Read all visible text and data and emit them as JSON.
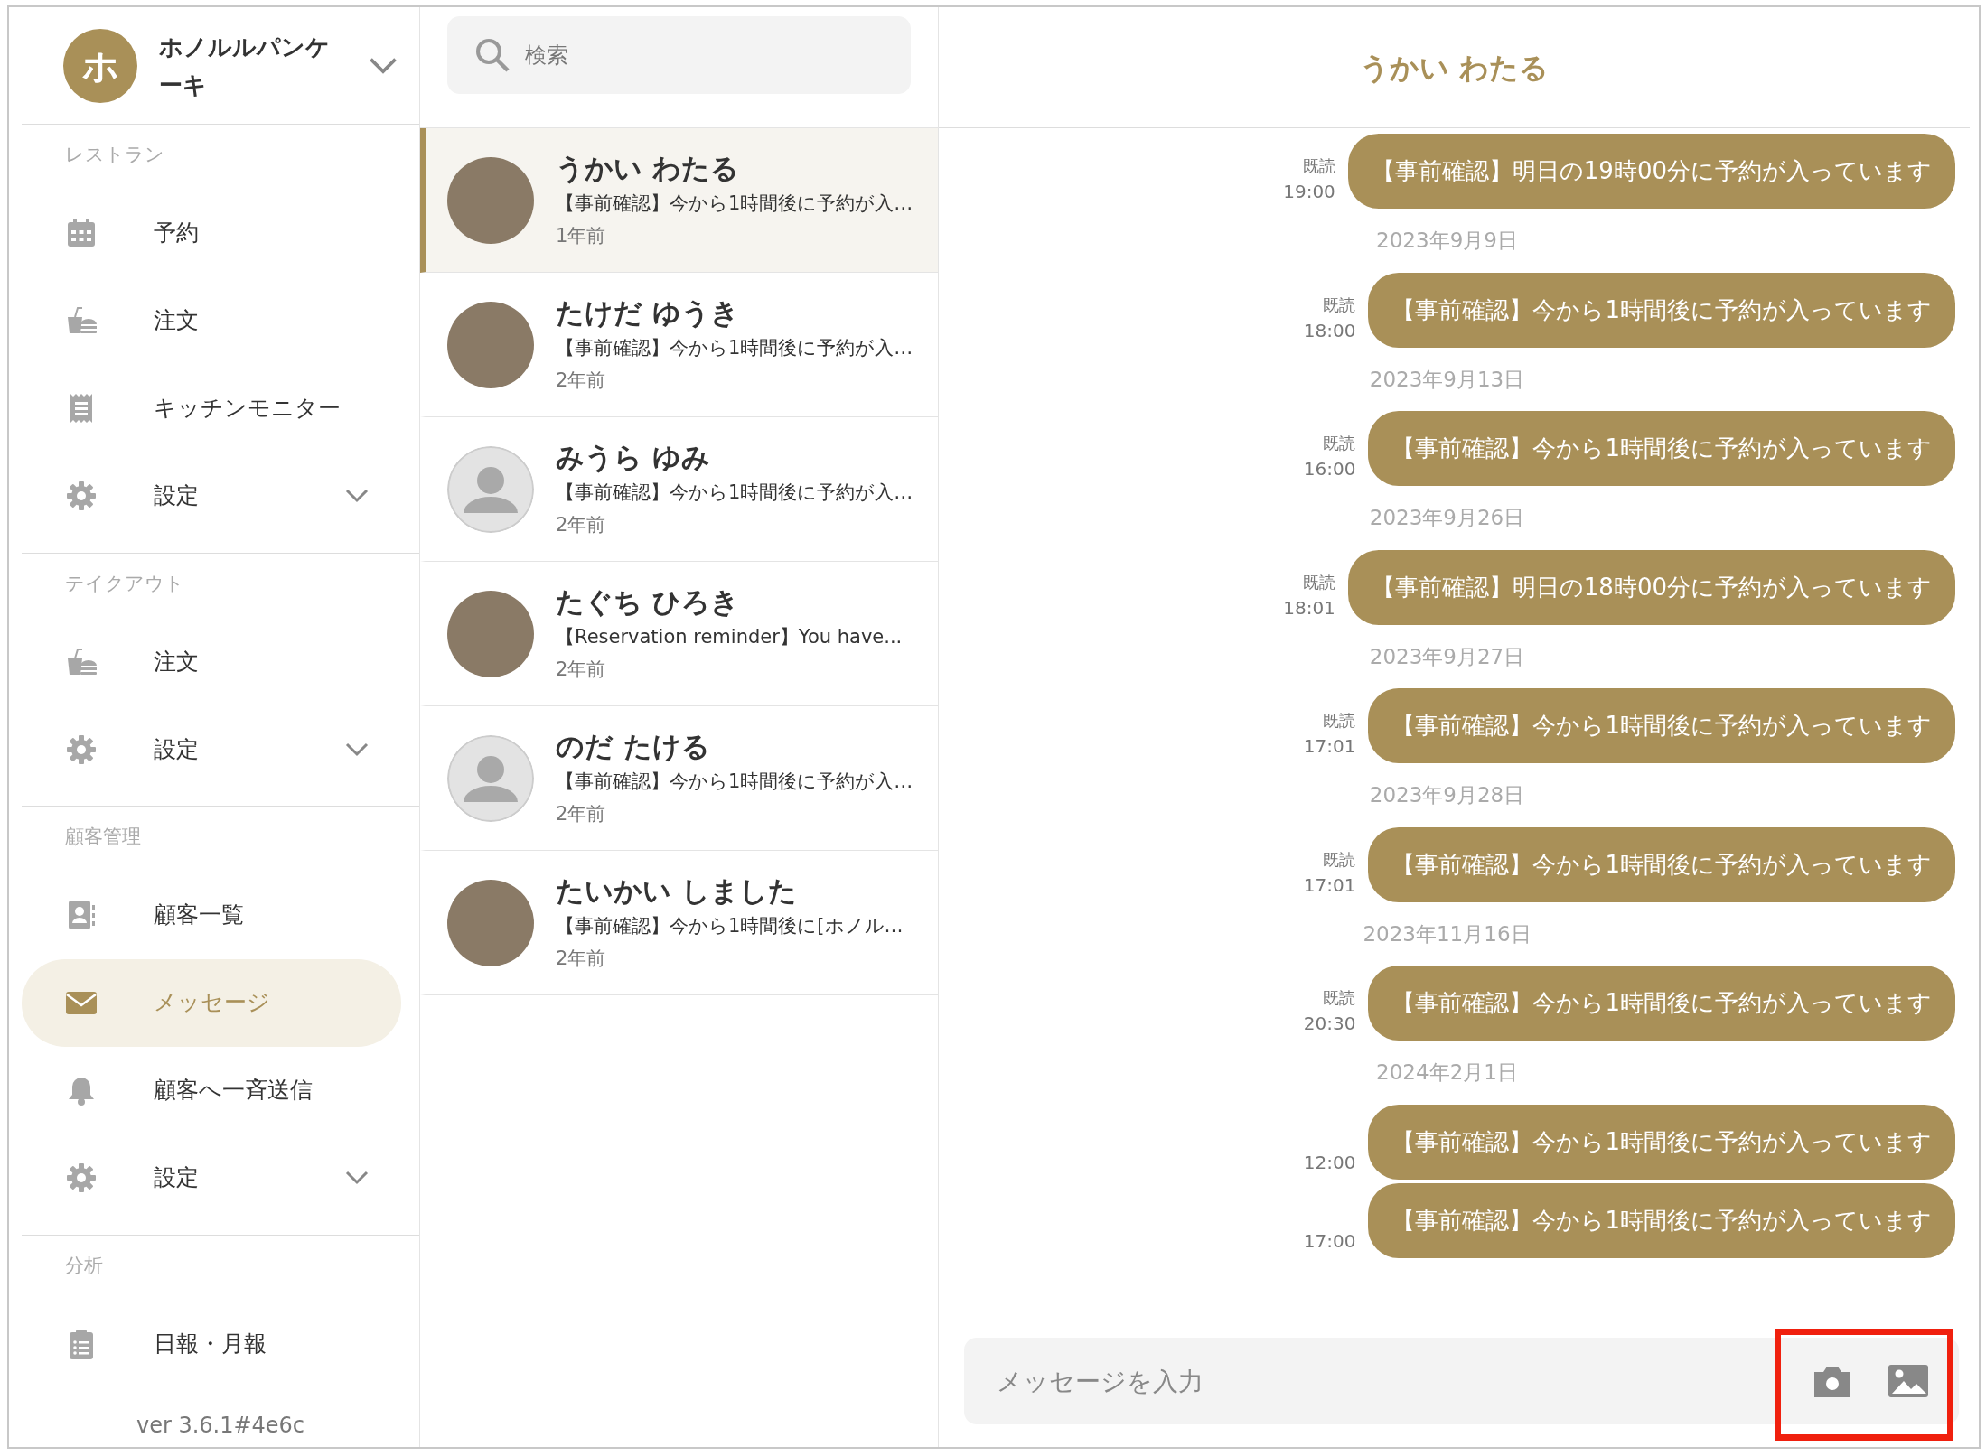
{
  "sidebar": {
    "store": {
      "initial": "ホ",
      "name": "ホノルルパンケーキ"
    },
    "sections": [
      {
        "label": "レストラン",
        "items": [
          {
            "label": "予約",
            "kind": "calendar",
            "expandable": false,
            "selected": false
          },
          {
            "label": "注文",
            "kind": "food",
            "expandable": false,
            "selected": false
          },
          {
            "label": "キッチンモニター",
            "kind": "receipt",
            "expandable": false,
            "selected": false
          },
          {
            "label": "設定",
            "kind": "gear",
            "expandable": true,
            "selected": false
          }
        ]
      },
      {
        "label": "テイクアウト",
        "items": [
          {
            "label": "注文",
            "kind": "food",
            "expandable": false,
            "selected": false
          },
          {
            "label": "設定",
            "kind": "gear",
            "expandable": true,
            "selected": false
          }
        ]
      },
      {
        "label": "顧客管理",
        "items": [
          {
            "label": "顧客一覧",
            "kind": "contact",
            "expandable": false,
            "selected": false
          },
          {
            "label": "メッセージ",
            "kind": "mail",
            "expandable": false,
            "selected": true
          },
          {
            "label": "顧客へ一斉送信",
            "kind": "bell",
            "expandable": false,
            "selected": false
          },
          {
            "label": "設定",
            "kind": "gear",
            "expandable": true,
            "selected": false
          }
        ]
      },
      {
        "label": "分析",
        "items": [
          {
            "label": "日報・月報",
            "kind": "clipboard",
            "expandable": false,
            "selected": false
          }
        ]
      }
    ],
    "version": "ver 3.6.1#4e6c"
  },
  "search": {
    "placeholder": "検索"
  },
  "conversations": [
    {
      "name": "うかい わたる",
      "preview": "【事前確認】今から1時間後に予約が入…",
      "time": "1年前",
      "kind": "photo",
      "selected": true
    },
    {
      "name": "たけだ ゆうき",
      "preview": "【事前確認】今から1時間後に予約が入…",
      "time": "2年前",
      "kind": "photo",
      "selected": false
    },
    {
      "name": "みうら ゆみ",
      "preview": "【事前確認】今から1時間後に予約が入…",
      "time": "2年前",
      "kind": "default",
      "selected": false
    },
    {
      "name": "たぐち ひろき",
      "preview": "【Reservation reminder】You have...",
      "time": "2年前",
      "kind": "photo",
      "selected": false
    },
    {
      "name": "のだ たける",
      "preview": "【事前確認】今から1時間後に予約が入…",
      "time": "2年前",
      "kind": "default",
      "selected": false
    },
    {
      "name": "たいかい しました",
      "preview": "【事前確認】今から1時間後に[ホノル…",
      "time": "2年前",
      "kind": "photo",
      "selected": false
    }
  ],
  "chat": {
    "title": "うかい わたる",
    "messages": [
      {
        "kind": "message",
        "read": "既読",
        "time": "19:00",
        "text": "【事前確認】明日の19時00分に予約が入っています"
      },
      {
        "kind": "date",
        "text": "2023年9月9日"
      },
      {
        "kind": "message",
        "read": "既読",
        "time": "18:00",
        "text": "【事前確認】今から1時間後に予約が入っています"
      },
      {
        "kind": "date",
        "text": "2023年9月13日"
      },
      {
        "kind": "message",
        "read": "既読",
        "time": "16:00",
        "text": "【事前確認】今から1時間後に予約が入っています"
      },
      {
        "kind": "date",
        "text": "2023年9月26日"
      },
      {
        "kind": "message",
        "read": "既読",
        "time": "18:01",
        "text": "【事前確認】明日の18時00分に予約が入っています"
      },
      {
        "kind": "date",
        "text": "2023年9月27日"
      },
      {
        "kind": "message",
        "read": "既読",
        "time": "17:01",
        "text": "【事前確認】今から1時間後に予約が入っています"
      },
      {
        "kind": "date",
        "text": "2023年9月28日"
      },
      {
        "kind": "message",
        "read": "既読",
        "time": "17:01",
        "text": "【事前確認】今から1時間後に予約が入っています"
      },
      {
        "kind": "date",
        "text": "2023年11月16日"
      },
      {
        "kind": "message",
        "read": "既読",
        "time": "20:30",
        "text": "【事前確認】今から1時間後に予約が入っています"
      },
      {
        "kind": "date",
        "text": "2024年2月1日"
      },
      {
        "kind": "message",
        "time": "12:00",
        "text": "【事前確認】今から1時間後に予約が入っています"
      },
      {
        "kind": "message",
        "time": "17:00",
        "text": "【事前確認】今から1時間後に予約が入っています"
      }
    ]
  },
  "composer": {
    "placeholder": "メッセージを入力",
    "highlighted": true
  }
}
